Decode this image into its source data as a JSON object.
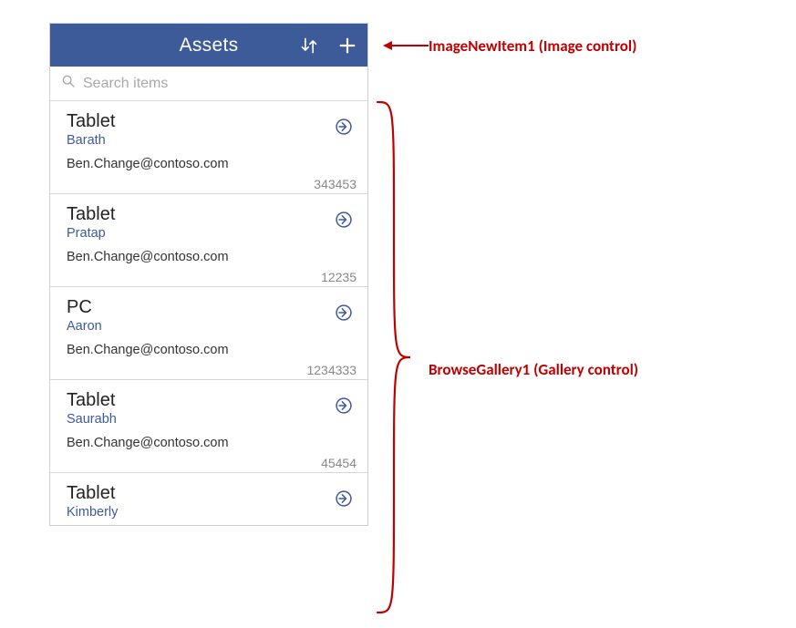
{
  "header": {
    "title": "Assets"
  },
  "search": {
    "placeholder": "Search items"
  },
  "gallery": {
    "items": [
      {
        "title": "Tablet",
        "subtitle": "Barath",
        "email": "Ben.Change@contoso.com",
        "number": "343453"
      },
      {
        "title": "Tablet",
        "subtitle": "Pratap",
        "email": "Ben.Change@contoso.com",
        "number": "12235"
      },
      {
        "title": "PC",
        "subtitle": "Aaron",
        "email": "Ben.Change@contoso.com",
        "number": "1234333"
      },
      {
        "title": "Tablet",
        "subtitle": "Saurabh",
        "email": "Ben.Change@contoso.com",
        "number": "45454"
      },
      {
        "title": "Tablet",
        "subtitle": "Kimberly",
        "email": "",
        "number": ""
      }
    ]
  },
  "annotations": {
    "top": "ImageNewItem1 (Image control)",
    "side": "BrowseGallery1 (Gallery control)"
  },
  "colors": {
    "brand": "#3D5A99",
    "callout": "#C00000"
  }
}
